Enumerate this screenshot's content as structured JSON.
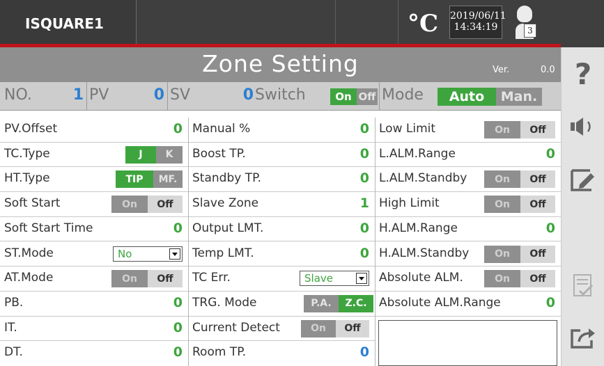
{
  "header": {
    "brand": "ISQUARE1",
    "unit": "°C",
    "date": "2019/06/11",
    "time": "14:34:19",
    "user_badge": "3"
  },
  "title": {
    "text": "Zone Setting",
    "ver_label": "Ver.",
    "ver_value": "0.0"
  },
  "status": {
    "no_label": "NO.",
    "no_value": "1",
    "pv_label": "PV",
    "pv_value": "0",
    "sv_label": "SV",
    "sv_value": "0",
    "switch_label": "Switch",
    "switch_on": "On",
    "switch_off": "Off",
    "mode_label": "Mode",
    "mode_auto": "Auto",
    "mode_man": "Man."
  },
  "col1": [
    {
      "label": "PV.Offset",
      "value": "0"
    },
    {
      "label": "TC.Type",
      "opt_a": "J",
      "opt_b": "K"
    },
    {
      "label": "HT.Type",
      "opt_a": "TIP",
      "opt_b": "MF."
    },
    {
      "label": "Soft Start",
      "opt_a": "On",
      "opt_b": "Off"
    },
    {
      "label": "Soft Start Time",
      "value": "0"
    },
    {
      "label": "ST.Mode",
      "select": "No"
    },
    {
      "label": "AT.Mode",
      "opt_a": "On",
      "opt_b": "Off"
    },
    {
      "label": "PB.",
      "value": "0"
    },
    {
      "label": "IT.",
      "value": "0"
    },
    {
      "label": "DT.",
      "value": "0"
    }
  ],
  "col2": [
    {
      "label": "Manual %",
      "value": "0"
    },
    {
      "label": "Boost TP.",
      "value": "0"
    },
    {
      "label": "Standby TP.",
      "value": "0"
    },
    {
      "label": "Slave Zone",
      "value": "1"
    },
    {
      "label": "Output LMT.",
      "value": "0"
    },
    {
      "label": "Temp LMT.",
      "value": "0"
    },
    {
      "label": "TC Err.",
      "select": "Slave"
    },
    {
      "label": "TRG. Mode",
      "opt_a": "P.A.",
      "opt_b": "Z.C."
    },
    {
      "label": "Current Detect",
      "opt_a": "On",
      "opt_b": "Off"
    },
    {
      "label": "Room TP.",
      "value": "0"
    }
  ],
  "col3": [
    {
      "label": "Low Limit",
      "opt_a": "On",
      "opt_b": "Off"
    },
    {
      "label": "L.ALM.Range",
      "value": "0"
    },
    {
      "label": "L.ALM.Standby",
      "opt_a": "On",
      "opt_b": "Off"
    },
    {
      "label": "High Limit",
      "opt_a": "On",
      "opt_b": "Off"
    },
    {
      "label": "H.ALM.Range",
      "value": "0"
    },
    {
      "label": "H.ALM.Standby",
      "opt_a": "On",
      "opt_b": "Off"
    },
    {
      "label": "Absolute ALM.",
      "opt_a": "On",
      "opt_b": "Off"
    },
    {
      "label": "Absolute ALM.Range",
      "value": "0"
    }
  ],
  "sidebar": {
    "help_glyph": "?"
  },
  "colors": {
    "accent_green": "#3ea53e",
    "value_blue": "#2d7fd1",
    "alarm_red": "#c0141c"
  }
}
